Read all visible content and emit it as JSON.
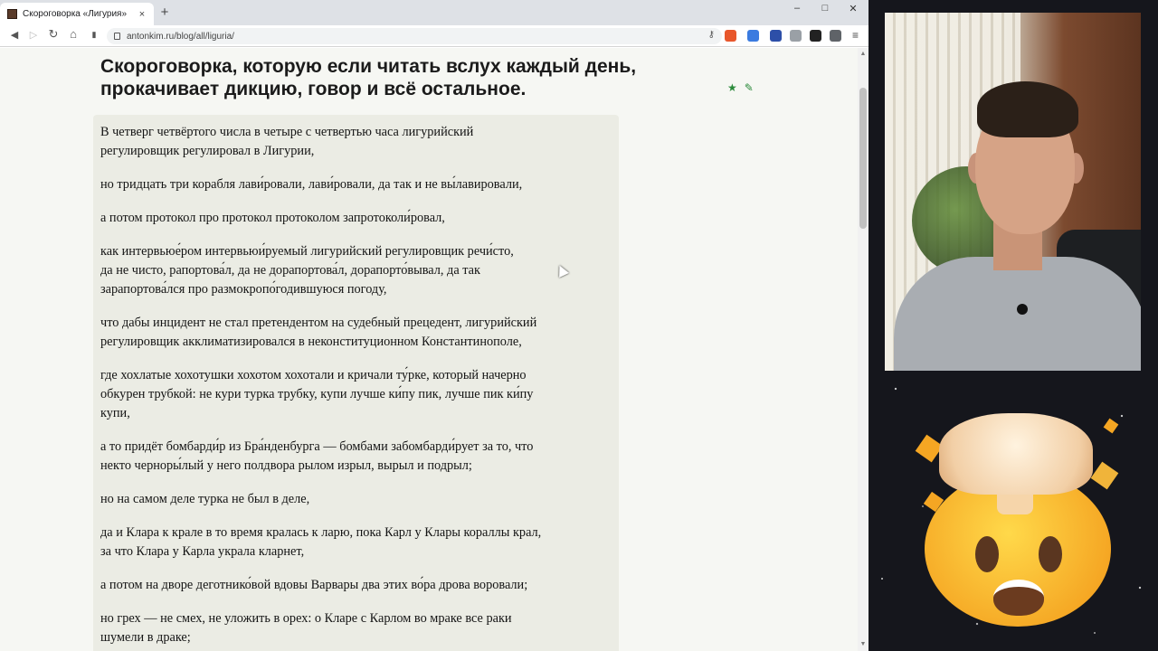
{
  "browser": {
    "tab": {
      "title": "Скороговорка «Лигурия»",
      "close_icon": "×"
    },
    "new_tab_icon": "+",
    "window_controls": {
      "minimize": "–",
      "maximize": "□",
      "close": "✕"
    },
    "nav": {
      "back": "◀",
      "forward": "▷",
      "reload": "↻",
      "home": "⌂",
      "bookmark": "▮"
    },
    "url": "antonkim.ru/blog/all/liguria/",
    "url_key_icon": "⚷"
  },
  "post": {
    "heading_lines": [
      "Скороговорка, которую если читать вслух каждый день,",
      "прокачивает дикцию, говор и всё остальное."
    ],
    "actions": {
      "star": "★",
      "edit": "✎"
    },
    "paragraphs": [
      [
        "В четверг четвёртого числа в четыре с четвертью часа лигурийский",
        "регулировщик регулировал в Лигурии,"
      ],
      [
        "но тридцать три корабля лави́ровали, лави́ровали, да так и не вы́лавировали,"
      ],
      [
        "а потом протокол про протокол протоколом запротоколи́ровал,"
      ],
      [
        "как интервьюе́ром интервьюи́руемый лигурийский регулировщик речи́сто,",
        "да не чисто, рапортова́л, да не дорапортова́л, дорапорто́вывал, да так",
        "зарапортова́лся про размокропо́годившуюся погоду,"
      ],
      [
        "что дабы инцидент не стал претендентом на судебный прецедент, лигурийский",
        "регулировщик акклиматизировался в неконституционном Константинополе,"
      ],
      [
        "где хохлатые хохотушки хохотом хохотали и кричали ту́рке, который начерно",
        "обкурен трубкой: не кури турка трубку, купи лучше ки́пу пик, лучше пик ки́пу",
        "купи,"
      ],
      [
        "а то придёт бомбарди́р из Бра́нденбурга — бомбами забомбарди́рует за то, что",
        "некто черноры́лый у него полдвора рылом изрыл, вырыл и подрыл;"
      ],
      [
        "но на самом деле турка не был в деле,"
      ],
      [
        "да и Клара к крале в то время кралась к ларю, пока Карл у Клары кораллы крал,",
        "за что Клара у Карла украла кларнет,"
      ],
      [
        "а потом на дворе деготнико́вой вдовы Варвары два этих во́ра дрова воровали;"
      ],
      [
        "но грех — не смех, не уложить в орех: о Кларе с Карлом во мраке все раки",
        "шумели в драке;"
      ]
    ]
  },
  "scrollbar": {
    "up": "▲",
    "down": "▼"
  }
}
